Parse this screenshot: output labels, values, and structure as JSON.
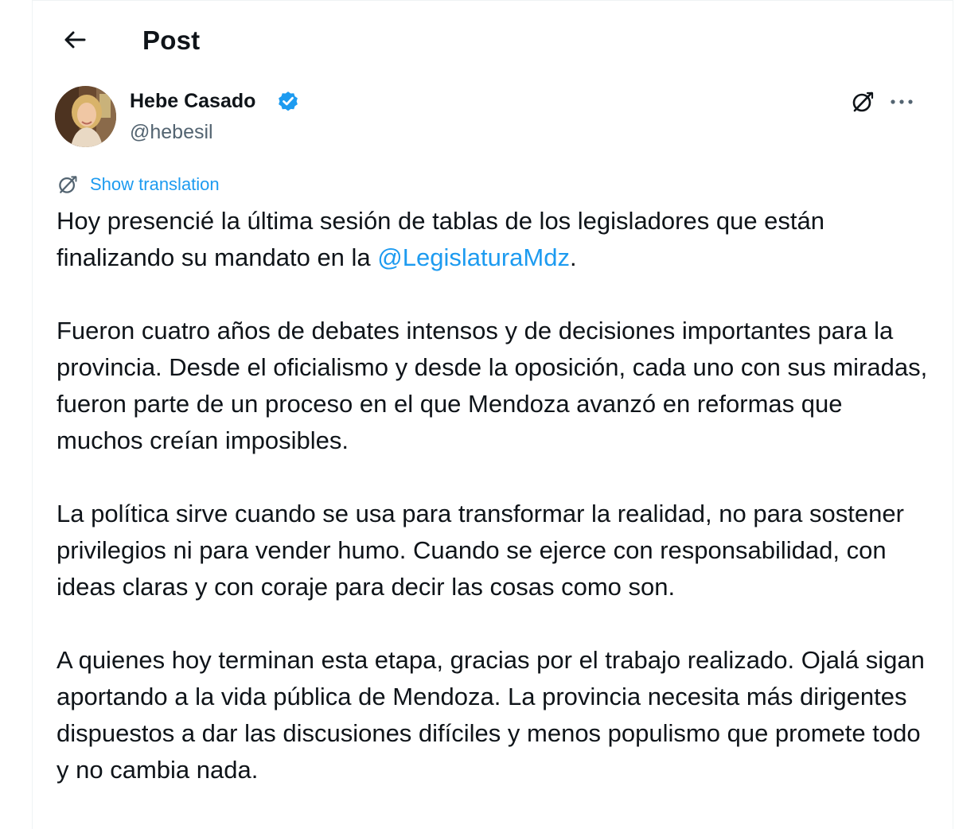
{
  "header": {
    "title": "Post",
    "back_icon": "arrow-left-icon"
  },
  "post": {
    "author": {
      "name": "Hebe Casado",
      "handle": "@hebesil",
      "verified": true,
      "verified_color": "#1d9bf0"
    },
    "actions": {
      "grok_icon": "grok-icon",
      "more_icon": "more-horizontal-icon"
    },
    "translation_label": "Show translation",
    "paragraphs": [
      {
        "before": "Hoy presencié la última sesión de tablas de los legisladores que están finalizando su mandato en la ",
        "mention": "@LegislaturaMdz",
        "after": "."
      },
      {
        "text": "Fueron cuatro años de debates intensos y de decisiones importantes para la provincia. Desde el oficialismo y desde la oposición, cada uno con sus miradas, fueron parte de un proceso en el que Mendoza avanzó en reformas que muchos creían imposibles."
      },
      {
        "text": "La política sirve cuando se usa para transformar la realidad, no para sostener privilegios ni para vender humo. Cuando se ejerce con responsabilidad, con ideas claras y con coraje para decir las cosas como son."
      },
      {
        "text": "A quienes hoy terminan esta etapa, gracias por el trabajo realizado. Ojalá sigan aportando a la vida pública de Mendoza. La provincia necesita más dirigentes dispuestos a dar las discusiones difíciles y menos populismo que promete todo y no cambia nada."
      }
    ]
  },
  "colors": {
    "text": "#0f1419",
    "secondary": "#536471",
    "link": "#1d9bf0"
  }
}
